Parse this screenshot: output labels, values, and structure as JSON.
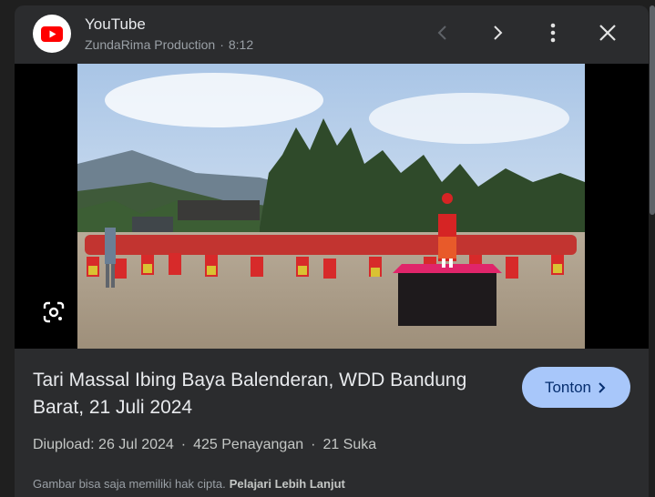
{
  "header": {
    "app_name": "YouTube",
    "channel": "ZundaRima Production",
    "separator": "·",
    "duration": "8:12",
    "logo_icon": "youtube-logo",
    "controls": [
      "chevron-left-icon",
      "chevron-right-icon",
      "more-vert-icon",
      "close-icon"
    ]
  },
  "media": {
    "image_subject": "mass dance performance on a field",
    "lens_icon": "google-lens-icon"
  },
  "video": {
    "title": "Tari Massal Ibing Baya Balenderan, WDD Bandung Barat, 21 Juli 2024",
    "upload_label": "Diupload: 26 Jul 2024",
    "views": "425 Penayangan",
    "likes": "21 Suka",
    "dot": "·"
  },
  "watch_button": {
    "label": "Tonton",
    "icon": "chevron-right-icon"
  },
  "notice": {
    "text": "Gambar bisa saja memiliki hak cipta.",
    "link": "Pelajari Lebih Lanjut"
  },
  "colors": {
    "background": "#1f1f1f",
    "panel": "#2b2c2e",
    "accent": "#a8c7fa",
    "youtube_red": "#ff0000"
  }
}
